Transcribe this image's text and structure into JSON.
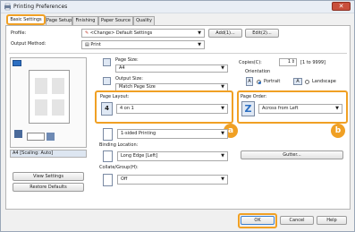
{
  "window": {
    "title": "Printing Preferences",
    "close": "✕"
  },
  "tabs": [
    "Basic Settings",
    "Page Setup",
    "Finishing",
    "Paper Source",
    "Quality"
  ],
  "profile": {
    "label": "Profile:",
    "value": "<Change> Default Settings",
    "add": "Add(1)...",
    "edit": "Edit(2)..."
  },
  "output": {
    "label": "Output Method:",
    "value": "Print"
  },
  "page_size": {
    "label": "Page Size:",
    "value": "A4"
  },
  "output_size": {
    "label": "Output Size:",
    "value": "Match Page Size"
  },
  "copies": {
    "label": "Copies(C):",
    "value": "1",
    "range": "[1 to 9999]"
  },
  "orientation": {
    "label": "Orientation",
    "portrait": "Portrait",
    "landscape": "Landscape",
    "selected": "Portrait"
  },
  "page_layout": {
    "label": "Page Layout:",
    "value": "4 on 1",
    "icon_text": "4"
  },
  "page_order": {
    "label": "Page Order:",
    "value": "Across from Left"
  },
  "printing": {
    "value": "1-sided Printing"
  },
  "binding": {
    "label": "Binding Location:",
    "value": "Long Edge [Left]"
  },
  "gutter": {
    "label": "Gutter..."
  },
  "collate": {
    "label": "Collate/Group(H):",
    "value": "Off"
  },
  "preview": {
    "caption": "A4 [Scaling: Auto]"
  },
  "left_buttons": {
    "view": "View Settings",
    "restore": "Restore Defaults"
  },
  "bottom": {
    "ok": "OK",
    "cancel": "Cancel",
    "help": "Help"
  },
  "badges": {
    "a": "a",
    "b": "b"
  },
  "colors": {
    "highlight": "#f0a024",
    "accent": "#2c6fc2"
  }
}
